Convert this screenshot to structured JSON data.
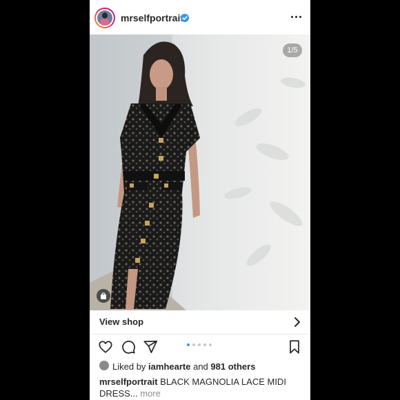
{
  "post": {
    "username": "mrselfportrait",
    "verified": true,
    "image_counter": "1/5",
    "view_shop_label": "View shop",
    "carousel": {
      "total": 5,
      "active_index": 0
    },
    "likes": {
      "prefix": "Liked by",
      "user": "iamhearte",
      "middle": "and",
      "others": "981 others"
    },
    "caption": {
      "username": "mrselfportrait",
      "text": "BLACK MAGNOLIA LACE MIDI DRESS...",
      "more_label": "more"
    }
  },
  "colors": {
    "background": "#000000",
    "panel": "#ffffff",
    "text": "#262626",
    "accent": "#3897f0",
    "muted": "#8e8e8e"
  },
  "icons": {
    "header_more": "more-horizontal-icon",
    "verified": "verified-badge-icon",
    "shop_chevron": "chevron-right-icon",
    "like": "heart-icon",
    "comment": "comment-icon",
    "share": "send-icon",
    "save": "bookmark-icon",
    "shopping": "shopping-bag-icon"
  }
}
